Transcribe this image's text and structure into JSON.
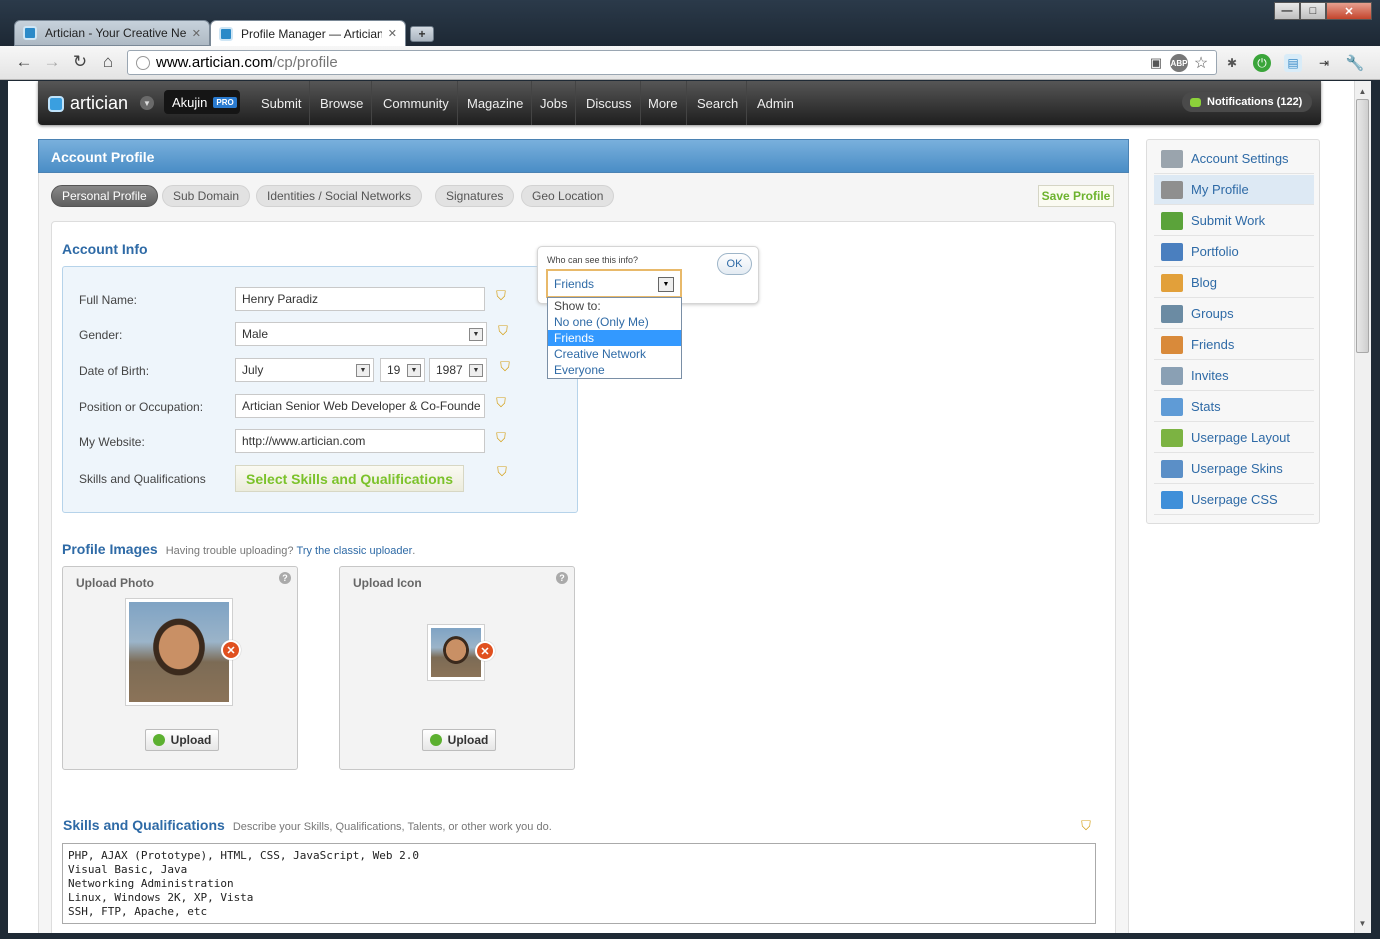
{
  "browser": {
    "tabs": [
      {
        "label": "Artician - Your Creative Net"
      },
      {
        "label": "Profile Manager — Artician"
      }
    ],
    "url_domain": "www.artician.com",
    "url_path": "/cp/profile",
    "window_controls": {
      "minimize": "—",
      "maximize": "□",
      "close": "✕"
    }
  },
  "sitenav": {
    "logo": "artician",
    "user": "Akujin",
    "user_badge": "PRO",
    "items": [
      "Submit",
      "Browse",
      "Community",
      "Magazine",
      "Jobs",
      "Discuss",
      "More",
      "Search",
      "Admin"
    ],
    "notifications": "Notifications (122)"
  },
  "header": {
    "title": "Account Profile"
  },
  "subtabs": [
    "Personal Profile",
    "Sub Domain",
    "Identities / Social Networks",
    "Signatures",
    "Geo Location"
  ],
  "save_label": "Save Profile",
  "account_info": {
    "title": "Account Info",
    "full_name_label": "Full Name:",
    "full_name": "Henry Paradiz",
    "gender_label": "Gender:",
    "gender": "Male",
    "dob_label": "Date of Birth:",
    "dob_month": "July",
    "dob_day": "19",
    "dob_year": "1987",
    "position_label": "Position or Occupation:",
    "position": "Artician Senior Web Developer & Co-Founde",
    "website_label": "My Website:",
    "website": "http://www.artician.com",
    "skills_label": "Skills and Qualifications",
    "skills_button": "Select Skills and Qualifications"
  },
  "privacy_popup": {
    "question": "Who can see this info?",
    "ok": "OK",
    "selected": "Friends",
    "header": "Show to:",
    "options": [
      "No one (Only Me)",
      "Friends",
      "Creative Network",
      "Everyone"
    ]
  },
  "profile_images": {
    "title": "Profile Images",
    "help_text": "Having trouble uploading?",
    "help_link": "Try the classic uploader",
    "help_end": ".",
    "photo_title": "Upload Photo",
    "icon_title": "Upload Icon",
    "upload_label": "Upload"
  },
  "skills": {
    "title": "Skills and Qualifications",
    "description": "Describe your Skills, Qualifications, Talents, or other work you do.",
    "text": "PHP, AJAX (Prototype), HTML, CSS, JavaScript, Web 2.0\nVisual Basic, Java\nNetworking Administration\nLinux, Windows 2K, XP, Vista\nSSH, FTP, Apache, etc"
  },
  "sidebar": {
    "items": [
      {
        "label": "Account Settings",
        "icon": "gears-icon",
        "color": "#9aa4ad"
      },
      {
        "label": "My Profile",
        "icon": "person-icon",
        "color": "#8f8f8f"
      },
      {
        "label": "Submit Work",
        "icon": "download-arrow-icon",
        "color": "#5ba33a"
      },
      {
        "label": "Portfolio",
        "icon": "portfolio-grid-icon",
        "color": "#4a7fbf"
      },
      {
        "label": "Blog",
        "icon": "pencil-icon",
        "color": "#e2a03a"
      },
      {
        "label": "Groups",
        "icon": "groups-icon",
        "color": "#6b8ba3"
      },
      {
        "label": "Friends",
        "icon": "friends-icon",
        "color": "#d98a3a"
      },
      {
        "label": "Invites",
        "icon": "envelope-icon",
        "color": "#8aa0b4"
      },
      {
        "label": "Stats",
        "icon": "bar-chart-icon",
        "color": "#5f9bd6"
      },
      {
        "label": "Userpage Layout",
        "icon": "layout-puzzle-icon",
        "color": "#7cb342"
      },
      {
        "label": "Userpage Skins",
        "icon": "skins-brush-icon",
        "color": "#5b8fc7"
      },
      {
        "label": "Userpage CSS",
        "icon": "css-window-icon",
        "color": "#3f8fd9"
      }
    ]
  }
}
